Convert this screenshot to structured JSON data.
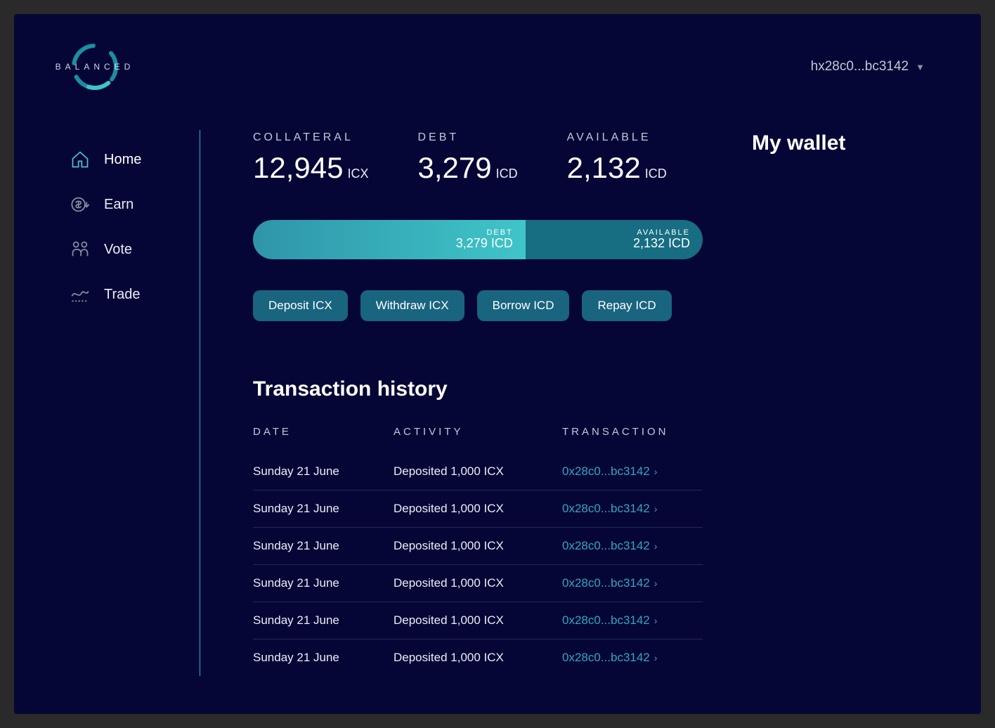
{
  "header": {
    "brand": "BALANCED",
    "wallet_address": "hx28c0...bc3142"
  },
  "sidebar": {
    "items": [
      {
        "label": "Home",
        "icon": "home",
        "active": true
      },
      {
        "label": "Earn",
        "icon": "earn",
        "active": false
      },
      {
        "label": "Vote",
        "icon": "vote",
        "active": false
      },
      {
        "label": "Trade",
        "icon": "trade",
        "active": false
      }
    ]
  },
  "stats": {
    "collateral": {
      "label": "COLLATERAL",
      "value": "12,945",
      "unit": "ICX"
    },
    "debt": {
      "label": "DEBT",
      "value": "3,279",
      "unit": "ICD"
    },
    "available": {
      "label": "AVAILABLE",
      "value": "2,132",
      "unit": "ICD"
    }
  },
  "bar": {
    "debt": {
      "label": "DEBT",
      "value": "3,279 ICD"
    },
    "available": {
      "label": "AVAILABLE",
      "value": "2,132 ICD"
    }
  },
  "actions": {
    "deposit": "Deposit ICX",
    "withdraw": "Withdraw ICX",
    "borrow": "Borrow ICD",
    "repay": "Repay ICD"
  },
  "history": {
    "title": "Transaction history",
    "headers": {
      "date": "DATE",
      "activity": "ACTIVITY",
      "transaction": "TRANSACTION"
    },
    "rows": [
      {
        "date": "Sunday 21 June",
        "activity": "Deposited 1,000 ICX",
        "tx": "0x28c0...bc3142"
      },
      {
        "date": "Sunday 21 June",
        "activity": "Deposited 1,000 ICX",
        "tx": "0x28c0...bc3142"
      },
      {
        "date": "Sunday 21 June",
        "activity": "Deposited 1,000 ICX",
        "tx": "0x28c0...bc3142"
      },
      {
        "date": "Sunday 21 June",
        "activity": "Deposited 1,000 ICX",
        "tx": "0x28c0...bc3142"
      },
      {
        "date": "Sunday 21 June",
        "activity": "Deposited 1,000 ICX",
        "tx": "0x28c0...bc3142"
      },
      {
        "date": "Sunday 21 June",
        "activity": "Deposited 1,000 ICX",
        "tx": "0x28c0...bc3142"
      }
    ]
  },
  "wallet_panel": {
    "title": "My wallet"
  }
}
